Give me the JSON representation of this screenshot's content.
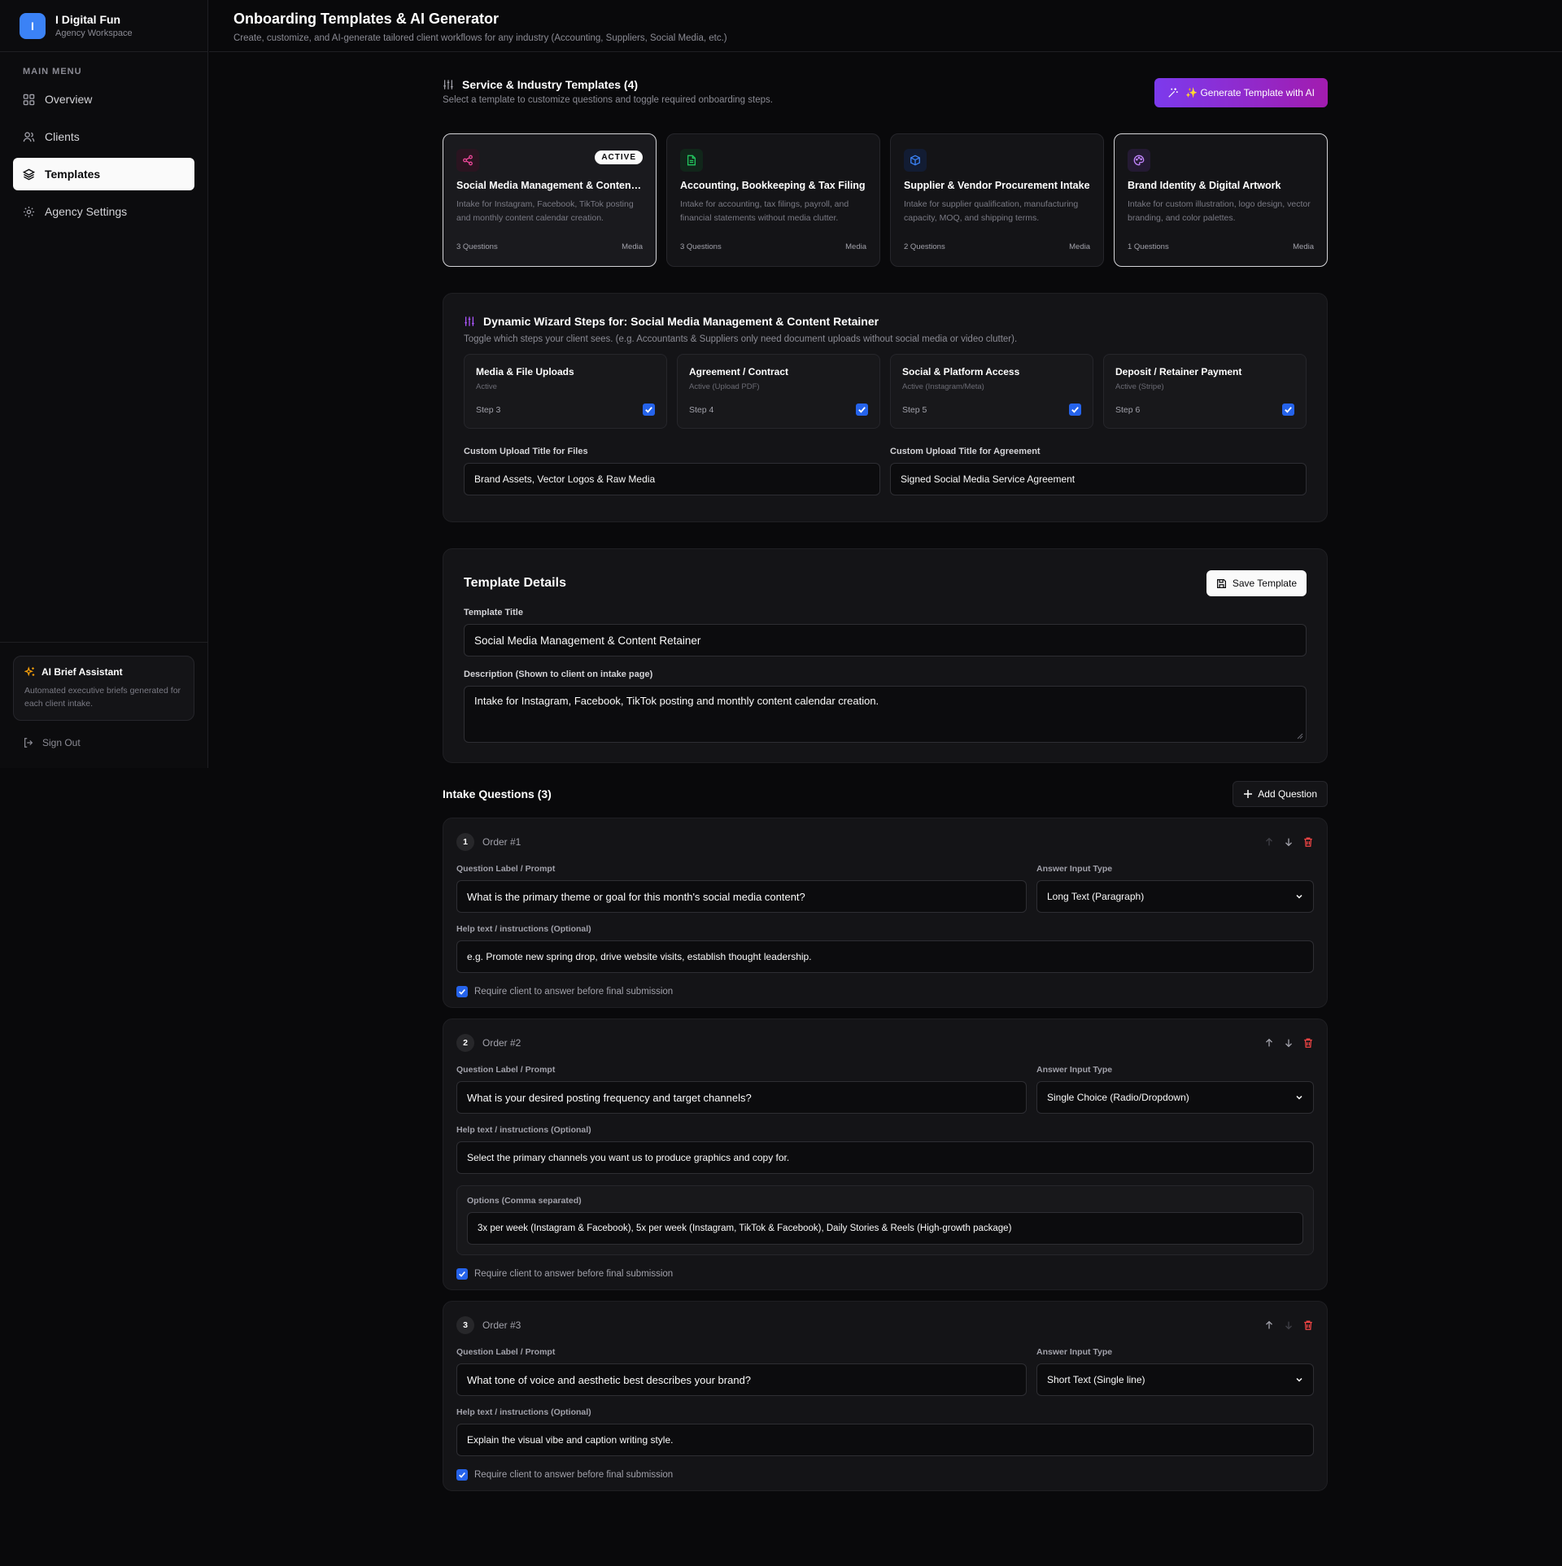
{
  "brand": {
    "initial": "I",
    "name": "I Digital Fun",
    "subtitle": "Agency Workspace"
  },
  "sidebar": {
    "menu_label": "MAIN MENU",
    "items": [
      {
        "label": "Overview",
        "icon": "grid-icon",
        "active": false
      },
      {
        "label": "Clients",
        "icon": "users-icon",
        "active": false
      },
      {
        "label": "Templates",
        "icon": "layers-icon",
        "active": true
      },
      {
        "label": "Agency Settings",
        "icon": "gear-icon",
        "active": false
      }
    ],
    "ai_card": {
      "title": "AI Brief Assistant",
      "description": "Automated executive briefs generated for each client intake."
    },
    "sign_out": "Sign Out"
  },
  "header": {
    "title": "Onboarding Templates & AI Generator",
    "subtitle": "Create, customize, and AI-generate tailored client workflows for any industry (Accounting, Suppliers, Social Media, etc.)"
  },
  "templates_section": {
    "title": "Service & Industry Templates (4)",
    "subtitle": "Select a template to customize questions and toggle required onboarding steps.",
    "generate_button": "✨ Generate Template with AI",
    "cards": [
      {
        "title": "Social Media Management & Content…",
        "description": "Intake for Instagram, Facebook, TikTok posting and monthly content calendar creation.",
        "questions": "3 Questions",
        "category": "Media",
        "badge": "ACTIVE",
        "icon": "share-icon",
        "color": "#ec4899"
      },
      {
        "title": "Accounting, Bookkeeping & Tax Filing",
        "description": "Intake for accounting, tax filings, payroll, and financial statements without media clutter.",
        "questions": "3 Questions",
        "category": "Media",
        "icon": "file-icon",
        "color": "#22c55e"
      },
      {
        "title": "Supplier & Vendor Procurement Intake",
        "description": "Intake for supplier qualification, manufacturing capacity, MOQ, and shipping terms.",
        "questions": "2 Questions",
        "category": "Media",
        "icon": "box-icon",
        "color": "#3b82f6"
      },
      {
        "title": "Brand Identity & Digital Artwork",
        "description": "Intake for custom illustration, logo design, vector branding, and color palettes.",
        "questions": "1 Questions",
        "category": "Media",
        "icon": "palette-icon",
        "color": "#c084fc"
      }
    ]
  },
  "wizard": {
    "title_prefix": "Dynamic Wizard Steps for:",
    "title_template": "Social Media Management & Content Retainer",
    "subtitle": "Toggle which steps your client sees. (e.g. Accountants & Suppliers only need document uploads without social media or video clutter).",
    "steps": [
      {
        "title": "Media & File Uploads",
        "status": "Active",
        "step": "Step 3",
        "checked": true
      },
      {
        "title": "Agreement / Contract",
        "status": "Active (Upload PDF)",
        "step": "Step 4",
        "checked": true
      },
      {
        "title": "Social & Platform Access",
        "status": "Active (Instagram/Meta)",
        "step": "Step 5",
        "checked": true
      },
      {
        "title": "Deposit / Retainer Payment",
        "status": "Active (Stripe)",
        "step": "Step 6",
        "checked": true
      }
    ],
    "files_label": "Custom Upload Title for Files",
    "files_value": "Brand Assets, Vector Logos & Raw Media",
    "agreement_label": "Custom Upload Title for Agreement",
    "agreement_value": "Signed Social Media Service Agreement"
  },
  "details": {
    "title": "Template Details",
    "save_button": "Save Template",
    "title_label": "Template Title",
    "title_value": "Social Media Management & Content Retainer",
    "description_label": "Description (Shown to client on intake page)",
    "description_value": "Intake for Instagram, Facebook, TikTok posting and monthly content calendar creation."
  },
  "questions": {
    "title": "Intake Questions (3)",
    "add_button": "Add Question",
    "label_caption": "Question Label / Prompt",
    "type_caption": "Answer Input Type",
    "help_caption": "Help text / instructions (Optional)",
    "options_caption": "Options (Comma separated)",
    "require_text": "Require client to answer before final submission",
    "items": [
      {
        "num": "1",
        "order": "Order #1",
        "label": "What is the primary theme or goal for this month's social media content?",
        "type": "Long Text (Paragraph)",
        "help": "e.g. Promote new spring drop, drive website visits, establish thought leadership.",
        "required": true
      },
      {
        "num": "2",
        "order": "Order #2",
        "label": "What is your desired posting frequency and target channels?",
        "type": "Single Choice (Radio/Dropdown)",
        "help": "Select the primary channels you want us to produce graphics and copy for.",
        "options": "3x per week (Instagram & Facebook), 5x per week (Instagram, TikTok & Facebook), Daily Stories & Reels (High-growth package)",
        "required": true
      },
      {
        "num": "3",
        "order": "Order #3",
        "label": "What tone of voice and aesthetic best describes your brand?",
        "type": "Short Text (Single line)",
        "help": "Explain the visual vibe and caption writing style.",
        "required": true
      }
    ]
  }
}
